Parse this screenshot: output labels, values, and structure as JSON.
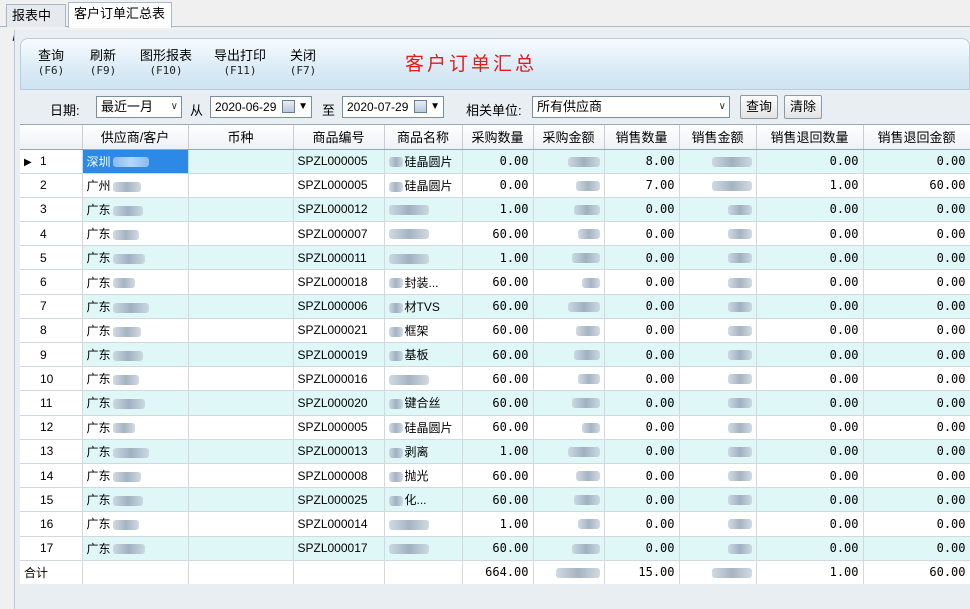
{
  "tabs": [
    {
      "label": "报表中心"
    },
    {
      "label": "客户订单汇总表"
    }
  ],
  "toolbar": {
    "buttons": [
      {
        "label": "查询",
        "key": "(F6)"
      },
      {
        "label": "刷新",
        "key": "(F9)"
      },
      {
        "label": "图形报表",
        "key": "(F10)"
      },
      {
        "label": "导出打印",
        "key": "(F11)"
      },
      {
        "label": "关闭",
        "key": "(F7)"
      }
    ],
    "title": "客户订单汇总"
  },
  "filters": {
    "date_label": "日期:",
    "range_value": "最近一月",
    "from_label": "从",
    "from_date": "2020-06-29",
    "to_label": "至",
    "to_date": "2020-07-29",
    "unit_label": "相关单位:",
    "unit_value": "所有供应商",
    "query_button": "查询",
    "clear_button": "清除"
  },
  "grid": {
    "columns": [
      "",
      "供应商/客户",
      "币种",
      "商品编号",
      "商品名称",
      "采购数量",
      "采购金额",
      "销售数量",
      "销售金额",
      "销售退回数量",
      "销售退回金额"
    ],
    "rows": [
      {
        "no": "1",
        "supplier": "深圳",
        "code": "SPZL000005",
        "name": "硅晶圆片",
        "pq": "0.00",
        "sq": "8.00",
        "rq": "0.00",
        "ra": "0.00"
      },
      {
        "no": "2",
        "supplier": "广州",
        "code": "SPZL000005",
        "name": "硅晶圆片",
        "pq": "0.00",
        "sq": "7.00",
        "rq": "1.00",
        "ra": "60.00"
      },
      {
        "no": "3",
        "supplier": "广东",
        "code": "SPZL000012",
        "name": "",
        "pq": "1.00",
        "sq": "0.00",
        "rq": "0.00",
        "ra": "0.00"
      },
      {
        "no": "4",
        "supplier": "广东",
        "code": "SPZL000007",
        "name": "",
        "pq": "60.00",
        "sq": "0.00",
        "rq": "0.00",
        "ra": "0.00"
      },
      {
        "no": "5",
        "supplier": "广东",
        "code": "SPZL000011",
        "name": "",
        "pq": "1.00",
        "sq": "0.00",
        "rq": "0.00",
        "ra": "0.00"
      },
      {
        "no": "6",
        "supplier": "广东",
        "code": "SPZL000018",
        "name": "封装...",
        "pq": "60.00",
        "sq": "0.00",
        "rq": "0.00",
        "ra": "0.00"
      },
      {
        "no": "7",
        "supplier": "广东",
        "code": "SPZL000006",
        "name": "材TVS",
        "pq": "60.00",
        "sq": "0.00",
        "rq": "0.00",
        "ra": "0.00"
      },
      {
        "no": "8",
        "supplier": "广东",
        "code": "SPZL000021",
        "name": "框架",
        "pq": "60.00",
        "sq": "0.00",
        "rq": "0.00",
        "ra": "0.00"
      },
      {
        "no": "9",
        "supplier": "广东",
        "code": "SPZL000019",
        "name": "基板",
        "pq": "60.00",
        "sq": "0.00",
        "rq": "0.00",
        "ra": "0.00"
      },
      {
        "no": "10",
        "supplier": "广东",
        "code": "SPZL000016",
        "name": "",
        "pq": "60.00",
        "sq": "0.00",
        "rq": "0.00",
        "ra": "0.00"
      },
      {
        "no": "11",
        "supplier": "广东",
        "code": "SPZL000020",
        "name": "键合丝",
        "pq": "60.00",
        "sq": "0.00",
        "rq": "0.00",
        "ra": "0.00"
      },
      {
        "no": "12",
        "supplier": "广东",
        "code": "SPZL000005",
        "name": "硅晶圆片",
        "pq": "60.00",
        "sq": "0.00",
        "rq": "0.00",
        "ra": "0.00"
      },
      {
        "no": "13",
        "supplier": "广东",
        "code": "SPZL000013",
        "name": "剥离",
        "pq": "1.00",
        "sq": "0.00",
        "rq": "0.00",
        "ra": "0.00"
      },
      {
        "no": "14",
        "supplier": "广东",
        "code": "SPZL000008",
        "name": "抛光",
        "pq": "60.00",
        "sq": "0.00",
        "rq": "0.00",
        "ra": "0.00"
      },
      {
        "no": "15",
        "supplier": "广东",
        "code": "SPZL000025",
        "name": "化...",
        "pq": "60.00",
        "sq": "0.00",
        "rq": "0.00",
        "ra": "0.00"
      },
      {
        "no": "16",
        "supplier": "广东",
        "code": "SPZL000014",
        "name": "",
        "pq": "1.00",
        "sq": "0.00",
        "rq": "0.00",
        "ra": "0.00"
      },
      {
        "no": "17",
        "supplier": "广东",
        "code": "SPZL000017",
        "name": "",
        "pq": "60.00",
        "sq": "0.00",
        "rq": "0.00",
        "ra": "0.00"
      }
    ],
    "total": {
      "label": "合计",
      "pq": "664.00",
      "sq": "15.00",
      "rq": "1.00",
      "ra": "60.00"
    }
  },
  "colors": {
    "title_red": "#e21b1b",
    "row_alt": "#dff7f7",
    "selection": "#2c8ae6"
  }
}
